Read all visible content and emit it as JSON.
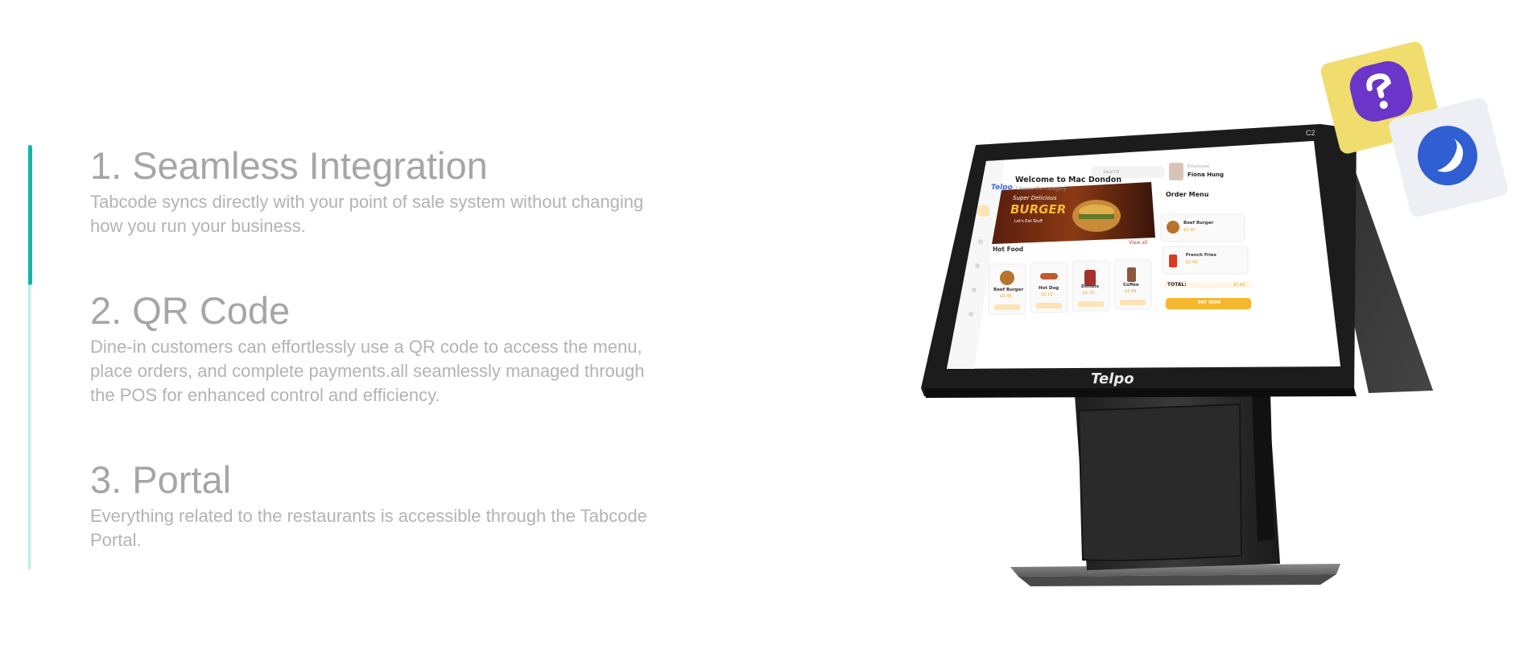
{
  "features": [
    {
      "title": "1. Seamless Integration",
      "description_line1": "Tabcode syncs directly with your point of sale system without changing",
      "description_line2": "how you run your business."
    },
    {
      "title": "2. QR Code",
      "description_line1": "Dine-in customers can effortlessly use a QR code to access the menu,",
      "description_line2": "place orders, and complete payments.all seamlessly managed through",
      "description_line3": "the POS for enhanced control and efficiency."
    },
    {
      "title": "3. Portal",
      "description_line1": "Everything related to the restaurants is accessible through the Tabcode",
      "description_line2": "Portal."
    }
  ],
  "active_feature_index": 0,
  "device": {
    "bezel_logo": "Telpo",
    "model": "C2",
    "screen": {
      "brand": "Telpo",
      "welcome": "Welcome to Mac Dondon",
      "subtitle": "Choose the category",
      "search_placeholder": "Search",
      "banner_line1": "Super Delicious",
      "banner_line2": "BURGER",
      "banner_line3": "Let's Eat Stuff",
      "section_title": "Hot Food",
      "view_all": "View all",
      "items": [
        {
          "name": "Beef Burger",
          "price": "$3.49"
        },
        {
          "name": "Hot Dog",
          "price": "$2.12"
        },
        {
          "name": "Donuts",
          "price": "$1.20"
        },
        {
          "name": "Coffee",
          "price": "$3.49"
        }
      ],
      "employee_label": "Employee",
      "employee_name": "Fiona Hung",
      "order_menu_title": "Order Menu",
      "order_items": [
        {
          "name": "Beef Burger",
          "price": "$3.49"
        },
        {
          "name": "French Fries",
          "price": "$2.49"
        }
      ],
      "total_label": "TOTAL:",
      "total_value": "$7.42",
      "pay_button": "PAY NOW"
    }
  },
  "colors": {
    "accent": "#12b5ad",
    "rail": "#b9ece6",
    "heading": "#a6a6a6",
    "body_text": "#b3b3b3",
    "card_yellow": "#f1dc6e",
    "badge_purple": "#6a35c8",
    "badge_blue": "#2f5fd3"
  },
  "icons": [
    "purple-app-icon",
    "blue-app-icon"
  ]
}
